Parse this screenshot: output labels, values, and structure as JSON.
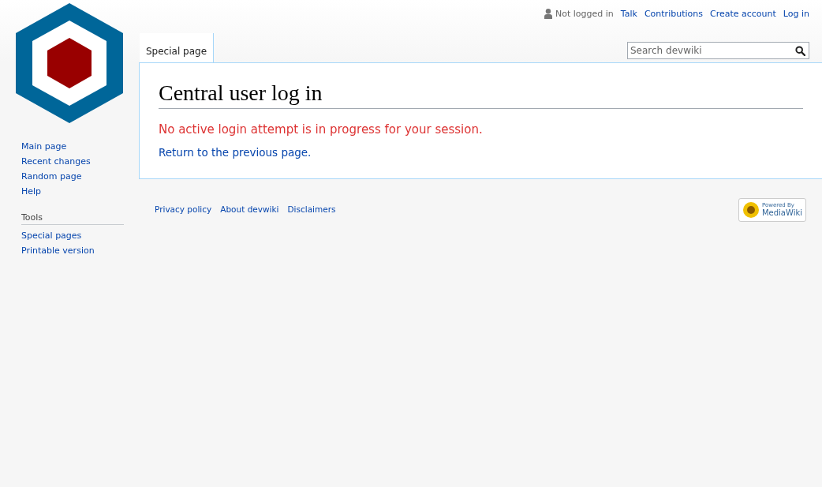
{
  "personal_tools": {
    "status": "Not logged in",
    "links": [
      "Talk",
      "Contributions",
      "Create account",
      "Log in"
    ]
  },
  "tabs": [
    {
      "label": "Special page",
      "selected": true
    }
  ],
  "search": {
    "placeholder": "Search devwiki"
  },
  "sidebar": {
    "navigation": [
      "Main page",
      "Recent changes",
      "Random page",
      "Help"
    ],
    "tools": {
      "heading": "Tools",
      "items": [
        "Special pages",
        "Printable version"
      ]
    }
  },
  "content": {
    "title": "Central user log in",
    "error": "No active login attempt is in progress for your session.",
    "return_link": "Return to the previous page."
  },
  "footer": {
    "links": [
      "Privacy policy",
      "About devwiki",
      "Disclaimers"
    ],
    "badge": {
      "line1": "Powered By",
      "line2": "MediaWiki"
    }
  }
}
